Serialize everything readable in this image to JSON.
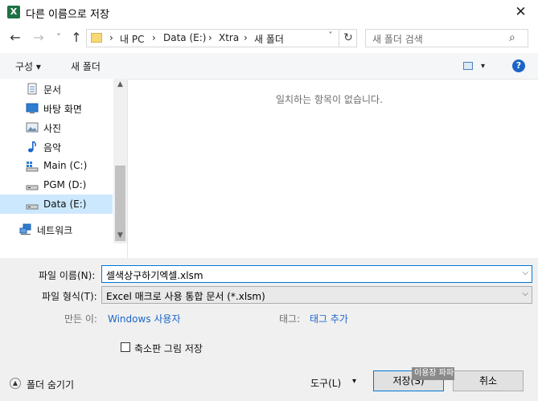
{
  "title_bar": {
    "title": "다른 이름으로 저장",
    "close_label": "✕"
  },
  "navigation": {
    "back_label": "←",
    "forward_label": "→",
    "recent_label": "˅",
    "up_label": "↑",
    "breadcrumb": [
      {
        "label": "내 PC",
        "sep": "›"
      },
      {
        "label": "Data (E:)",
        "sep": "›"
      },
      {
        "label": "Xtra",
        "sep": "›"
      },
      {
        "label": "새 폴더"
      }
    ],
    "breadcrumb_lead_sep": "›",
    "dropdown_label": "˅",
    "refresh_label": "↻",
    "search_placeholder": "새 폴더 검색"
  },
  "toolbar": {
    "organize_label": "구성 ▾",
    "new_folder_label": "새 폴더",
    "view_dropdown": "▾",
    "help_label": "?"
  },
  "nav_pane": {
    "items": [
      {
        "label": "문서",
        "icon": "document-icon"
      },
      {
        "label": "바탕 화면",
        "icon": "desktop-icon"
      },
      {
        "label": "사진",
        "icon": "pictures-icon"
      },
      {
        "label": "음악",
        "icon": "music-icon"
      },
      {
        "label": "Main (C:)",
        "icon": "drive-c-icon"
      },
      {
        "label": "PGM (D:)",
        "icon": "drive-icon"
      },
      {
        "label": "Data (E:)",
        "icon": "drive-icon",
        "selected": true
      },
      {
        "label": "네트워크",
        "icon": "network-icon"
      }
    ]
  },
  "content": {
    "empty_message": "일치하는 항목이 없습니다."
  },
  "form": {
    "filename_label": "파일 이름(N):",
    "filename_value": "셀색상구하기엑셀.xlsm",
    "filetype_label": "파일 형식(T):",
    "filetype_value": "Excel 매크로 사용 통합 문서 (*.xlsm)",
    "author_label": "만든 이:",
    "author_value": "Windows 사용자",
    "tags_label": "태그:",
    "tags_value": "태그 추가",
    "thumbnail_label": "축소판 그림 저장"
  },
  "footer": {
    "hide_folders_label": "폴더 숨기기",
    "tools_label": "도구(L)",
    "tools_dropdown": "▾",
    "save_label": "저장(S)",
    "cancel_label": "취소",
    "tooltip_label": "이용장 파파"
  },
  "colors": {
    "accent": "#0078d7",
    "selection": "#cce8ff",
    "link": "#1b65c8",
    "excel_green": "#1e7145"
  }
}
